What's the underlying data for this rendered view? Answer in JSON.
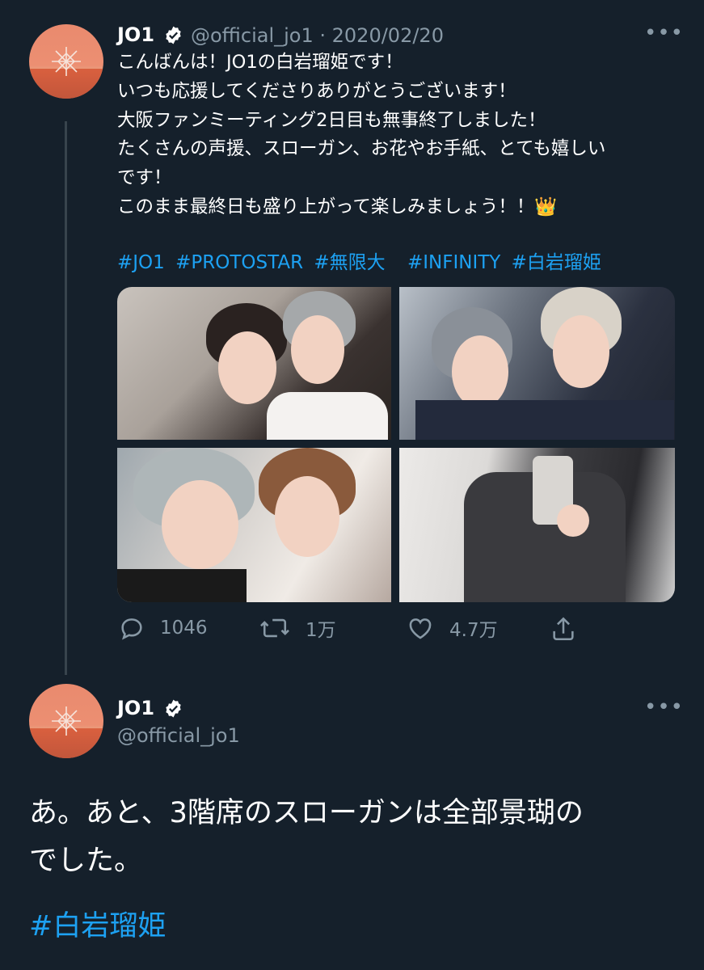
{
  "tweet1": {
    "author_name": "JO1",
    "handle_date": "@official_jo1 · 2020/02/20",
    "lines": [
      "こんばんは！JO1の白岩瑠姫です！",
      "いつも応援してくださりありがとうございます！",
      "大阪ファンミーティング2日目も無事終了しました！",
      "たくさんの声援、スローガン、お花やお手紙、とても嬉しい",
      "です！",
      "このまま最終日も盛り上がって楽しみましょう！！👑"
    ],
    "hashtags": [
      "#JO1",
      "#PROTOSTAR",
      "#無限大",
      " #INFINITY",
      "#白岩瑠姫"
    ],
    "counts": {
      "reply": "1046",
      "retweet": "1万",
      "like": "4.7万"
    }
  },
  "tweet2": {
    "author_name": "JO1",
    "handle": "@official_jo1",
    "text_lines": [
      "あ。あと、3階席のスローガンは全部景瑚の",
      "でした。"
    ],
    "hashtag": "#白岩瑠姫"
  },
  "colors": {
    "background": "#15202b",
    "link": "#1da1f2",
    "secondary": "#8899a6",
    "text": "#ffffff"
  },
  "icons": [
    "verified-badge-icon",
    "more-options-icon",
    "reply-icon",
    "retweet-icon",
    "like-icon",
    "share-icon"
  ]
}
